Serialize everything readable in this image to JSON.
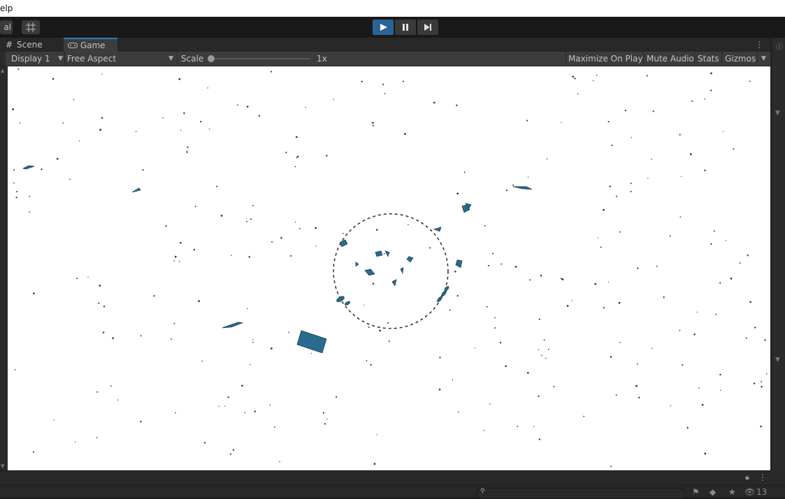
{
  "menubar": {
    "help_label": "elp"
  },
  "toolbar": {
    "layers_label": "al",
    "grid_icon": "grid-snap-icon",
    "play_icon": "play-icon",
    "pause_icon": "pause-icon",
    "step_icon": "step-icon",
    "accent_color": "#2a6496"
  },
  "tabs": [
    {
      "label": "Scene",
      "icon": "scene-grid-icon"
    },
    {
      "label": "Game",
      "icon": "gamepad-icon"
    }
  ],
  "game_toolbar": {
    "display": "Display 1",
    "aspect": "Free Aspect",
    "scale_label": "Scale",
    "scale_value": "1x",
    "scale_fraction": 0.0,
    "maximize": "Maximize On Play",
    "mute": "Mute Audio",
    "stats": "Stats",
    "gizmos": "Gizmos"
  },
  "game_view": {
    "background": "#ffffff",
    "object_color": "#2b6b8f"
  },
  "bottom": {
    "hidden_count": "13"
  }
}
